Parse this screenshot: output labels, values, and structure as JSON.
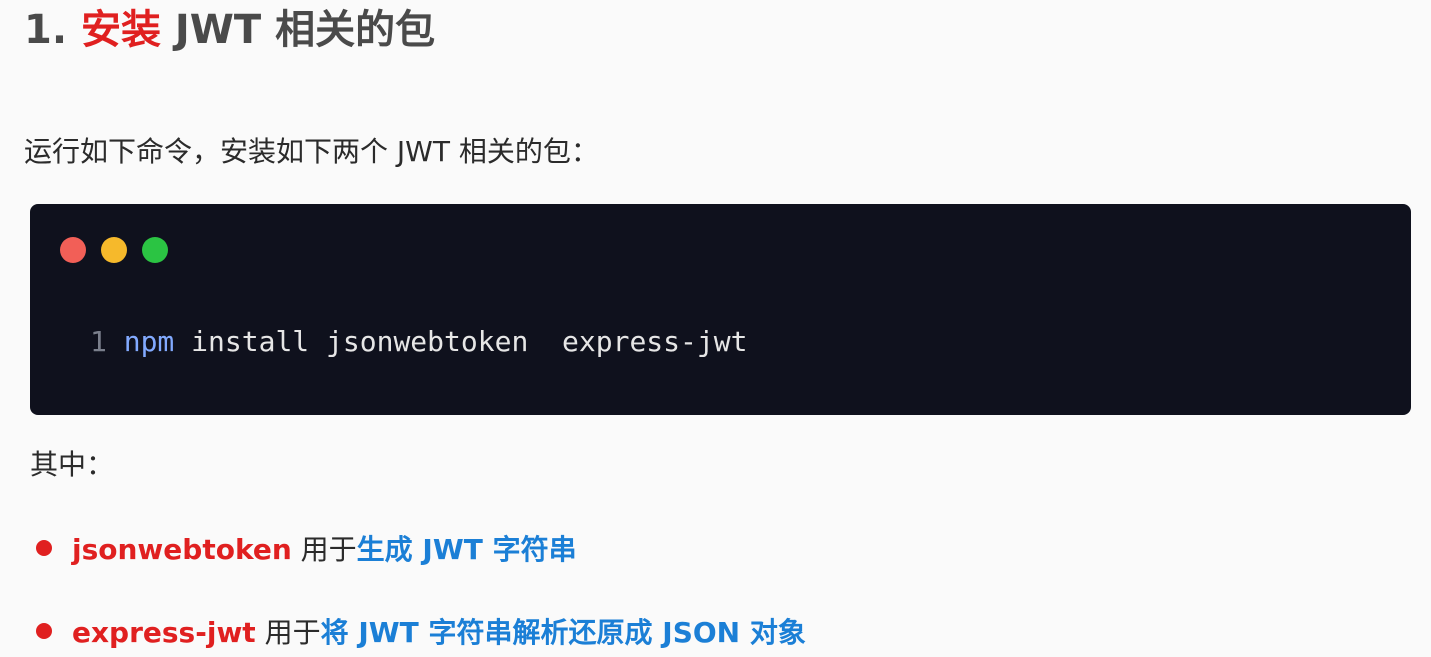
{
  "heading": {
    "number": "1.",
    "accent": "安装",
    "rest": "JWT 相关的包"
  },
  "intro": "运行如下命令，安装如下两个 JWT 相关的包：",
  "code": {
    "line_number": "1",
    "command": "npm",
    "args": "install jsonwebtoken  express-jwt"
  },
  "among_label": "其中：",
  "items": [
    {
      "package": "jsonwebtoken",
      "connector": "用于",
      "purpose": "生成 JWT 字符串"
    },
    {
      "package": "express-jwt",
      "connector": "用于",
      "purpose": "将 JWT 字符串解析还原成 JSON 对象"
    }
  ],
  "colors": {
    "accent_red": "#e02020",
    "accent_blue": "#1b7fd6",
    "code_bg": "#0f111d",
    "mac_red": "#f25f57",
    "mac_yellow": "#f6b92b",
    "mac_green": "#2bc443"
  }
}
